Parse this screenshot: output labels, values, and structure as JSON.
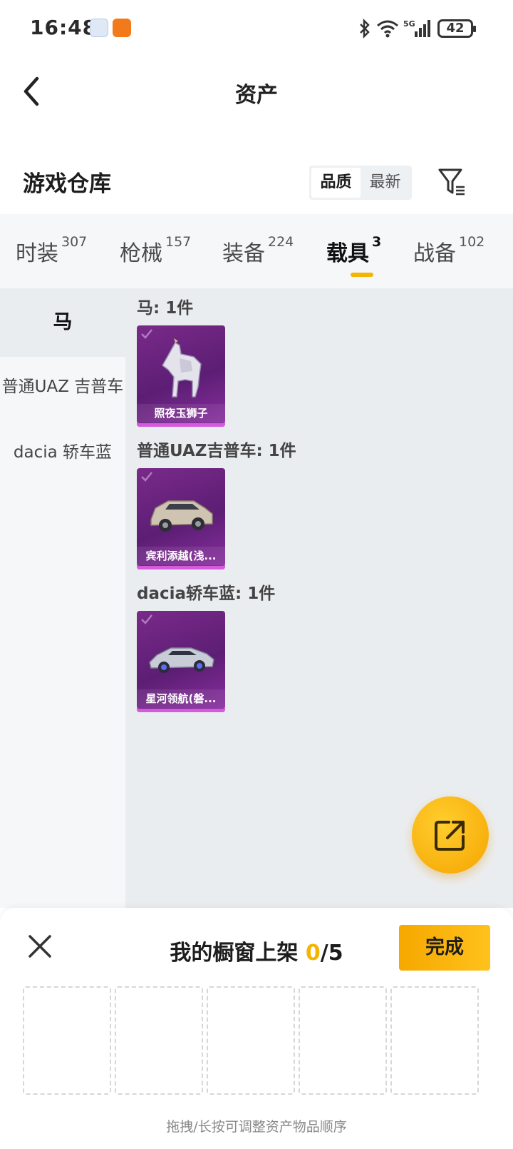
{
  "status": {
    "time": "16:48",
    "battery": "42"
  },
  "header": {
    "title": "资产"
  },
  "warehouse": {
    "title": "游戏仓库",
    "sort_options": [
      "品质",
      "最新"
    ]
  },
  "tabs": [
    {
      "label": "时装",
      "count": "307"
    },
    {
      "label": "枪械",
      "count": "157"
    },
    {
      "label": "装备",
      "count": "224"
    },
    {
      "label": "载具",
      "count": "3"
    },
    {
      "label": "战备",
      "count": "102"
    }
  ],
  "sidebar": {
    "items": [
      "马",
      "普通UAZ 吉普车",
      "dacia 轿车蓝"
    ]
  },
  "groups": [
    {
      "title": "马: 1件",
      "item_name": "照夜玉狮子"
    },
    {
      "title": "普通UAZ吉普车: 1件",
      "item_name": "宾利添越(浅..."
    },
    {
      "title": "dacia轿车蓝: 1件",
      "item_name": "星河领航(磐..."
    }
  ],
  "sheet": {
    "title_prefix": "我的橱窗上架 ",
    "count_current": "0",
    "count_total": "/5",
    "done_label": "完成",
    "hint": "拖拽/长按可调整资产物品顺序"
  },
  "colors": {
    "accent": "#f5b400",
    "card_purple": "#6b2282"
  }
}
